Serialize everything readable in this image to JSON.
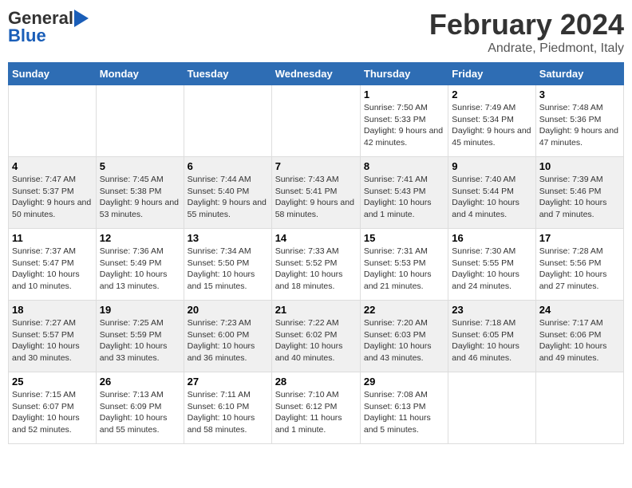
{
  "header": {
    "logo_line1": "General",
    "logo_line2": "Blue",
    "main_title": "February 2024",
    "subtitle": "Andrate, Piedmont, Italy"
  },
  "calendar": {
    "days_of_week": [
      "Sunday",
      "Monday",
      "Tuesday",
      "Wednesday",
      "Thursday",
      "Friday",
      "Saturday"
    ],
    "weeks": [
      [
        {
          "date": "",
          "info": ""
        },
        {
          "date": "",
          "info": ""
        },
        {
          "date": "",
          "info": ""
        },
        {
          "date": "",
          "info": ""
        },
        {
          "date": "1",
          "info": "Sunrise: 7:50 AM\nSunset: 5:33 PM\nDaylight: 9 hours and 42 minutes."
        },
        {
          "date": "2",
          "info": "Sunrise: 7:49 AM\nSunset: 5:34 PM\nDaylight: 9 hours and 45 minutes."
        },
        {
          "date": "3",
          "info": "Sunrise: 7:48 AM\nSunset: 5:36 PM\nDaylight: 9 hours and 47 minutes."
        }
      ],
      [
        {
          "date": "4",
          "info": "Sunrise: 7:47 AM\nSunset: 5:37 PM\nDaylight: 9 hours and 50 minutes."
        },
        {
          "date": "5",
          "info": "Sunrise: 7:45 AM\nSunset: 5:38 PM\nDaylight: 9 hours and 53 minutes."
        },
        {
          "date": "6",
          "info": "Sunrise: 7:44 AM\nSunset: 5:40 PM\nDaylight: 9 hours and 55 minutes."
        },
        {
          "date": "7",
          "info": "Sunrise: 7:43 AM\nSunset: 5:41 PM\nDaylight: 9 hours and 58 minutes."
        },
        {
          "date": "8",
          "info": "Sunrise: 7:41 AM\nSunset: 5:43 PM\nDaylight: 10 hours and 1 minute."
        },
        {
          "date": "9",
          "info": "Sunrise: 7:40 AM\nSunset: 5:44 PM\nDaylight: 10 hours and 4 minutes."
        },
        {
          "date": "10",
          "info": "Sunrise: 7:39 AM\nSunset: 5:46 PM\nDaylight: 10 hours and 7 minutes."
        }
      ],
      [
        {
          "date": "11",
          "info": "Sunrise: 7:37 AM\nSunset: 5:47 PM\nDaylight: 10 hours and 10 minutes."
        },
        {
          "date": "12",
          "info": "Sunrise: 7:36 AM\nSunset: 5:49 PM\nDaylight: 10 hours and 13 minutes."
        },
        {
          "date": "13",
          "info": "Sunrise: 7:34 AM\nSunset: 5:50 PM\nDaylight: 10 hours and 15 minutes."
        },
        {
          "date": "14",
          "info": "Sunrise: 7:33 AM\nSunset: 5:52 PM\nDaylight: 10 hours and 18 minutes."
        },
        {
          "date": "15",
          "info": "Sunrise: 7:31 AM\nSunset: 5:53 PM\nDaylight: 10 hours and 21 minutes."
        },
        {
          "date": "16",
          "info": "Sunrise: 7:30 AM\nSunset: 5:55 PM\nDaylight: 10 hours and 24 minutes."
        },
        {
          "date": "17",
          "info": "Sunrise: 7:28 AM\nSunset: 5:56 PM\nDaylight: 10 hours and 27 minutes."
        }
      ],
      [
        {
          "date": "18",
          "info": "Sunrise: 7:27 AM\nSunset: 5:57 PM\nDaylight: 10 hours and 30 minutes."
        },
        {
          "date": "19",
          "info": "Sunrise: 7:25 AM\nSunset: 5:59 PM\nDaylight: 10 hours and 33 minutes."
        },
        {
          "date": "20",
          "info": "Sunrise: 7:23 AM\nSunset: 6:00 PM\nDaylight: 10 hours and 36 minutes."
        },
        {
          "date": "21",
          "info": "Sunrise: 7:22 AM\nSunset: 6:02 PM\nDaylight: 10 hours and 40 minutes."
        },
        {
          "date": "22",
          "info": "Sunrise: 7:20 AM\nSunset: 6:03 PM\nDaylight: 10 hours and 43 minutes."
        },
        {
          "date": "23",
          "info": "Sunrise: 7:18 AM\nSunset: 6:05 PM\nDaylight: 10 hours and 46 minutes."
        },
        {
          "date": "24",
          "info": "Sunrise: 7:17 AM\nSunset: 6:06 PM\nDaylight: 10 hours and 49 minutes."
        }
      ],
      [
        {
          "date": "25",
          "info": "Sunrise: 7:15 AM\nSunset: 6:07 PM\nDaylight: 10 hours and 52 minutes."
        },
        {
          "date": "26",
          "info": "Sunrise: 7:13 AM\nSunset: 6:09 PM\nDaylight: 10 hours and 55 minutes."
        },
        {
          "date": "27",
          "info": "Sunrise: 7:11 AM\nSunset: 6:10 PM\nDaylight: 10 hours and 58 minutes."
        },
        {
          "date": "28",
          "info": "Sunrise: 7:10 AM\nSunset: 6:12 PM\nDaylight: 11 hours and 1 minute."
        },
        {
          "date": "29",
          "info": "Sunrise: 7:08 AM\nSunset: 6:13 PM\nDaylight: 11 hours and 5 minutes."
        },
        {
          "date": "",
          "info": ""
        },
        {
          "date": "",
          "info": ""
        }
      ]
    ]
  }
}
